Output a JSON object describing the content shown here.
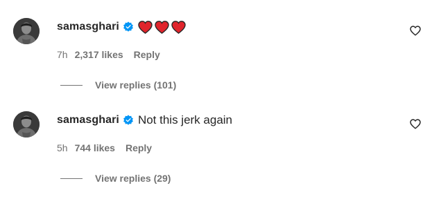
{
  "colors": {
    "text_primary": "#262626",
    "text_secondary": "#737373",
    "verified_blue": "#0095F6",
    "heart_red": "#E0242C"
  },
  "comments": [
    {
      "username": "samasghari",
      "verified": true,
      "text": "",
      "emoji": [
        "heart",
        "heart",
        "heart"
      ],
      "time": "7h",
      "likes": "2,317 likes",
      "reply_label": "Reply",
      "view_replies": "View replies (101)",
      "like_icon": "heart-outline-icon"
    },
    {
      "username": "samasghari",
      "verified": true,
      "text": "Not this jerk again",
      "emoji": [],
      "time": "5h",
      "likes": "744 likes",
      "reply_label": "Reply",
      "view_replies": "View replies (29)",
      "like_icon": "heart-outline-icon"
    }
  ]
}
